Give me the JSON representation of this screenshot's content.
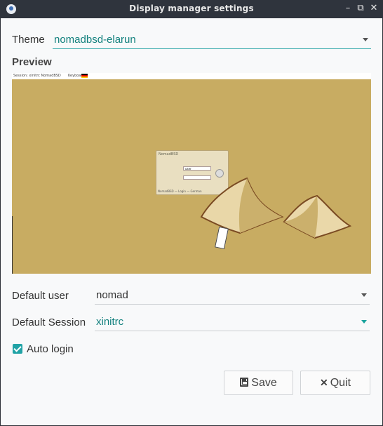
{
  "window": {
    "title": "Display manager settings",
    "controls": {
      "minimize": "–",
      "maximize": "⧉",
      "close": "✕"
    }
  },
  "theme": {
    "label": "Theme",
    "value": "nomadbsd-elarun"
  },
  "preview": {
    "title": "Preview",
    "mini_topbar_left": "Session: xinitrc   NomadBSD",
    "mini_topbar_right": "Keyboard",
    "login_box_title": "NomadBSD",
    "login_user": "user",
    "login_footer": "NomadBSD — Login — German"
  },
  "default_user": {
    "label": "Default user",
    "value": "nomad"
  },
  "default_session": {
    "label": "Default Session",
    "value": "xinitrc"
  },
  "auto_login": {
    "label": "Auto login",
    "checked": true
  },
  "buttons": {
    "save": "Save",
    "quit": "Quit"
  },
  "colors": {
    "accent": "#21a3a6",
    "title_bar": "#2f343d",
    "preview_bg": "#c8ac62"
  }
}
